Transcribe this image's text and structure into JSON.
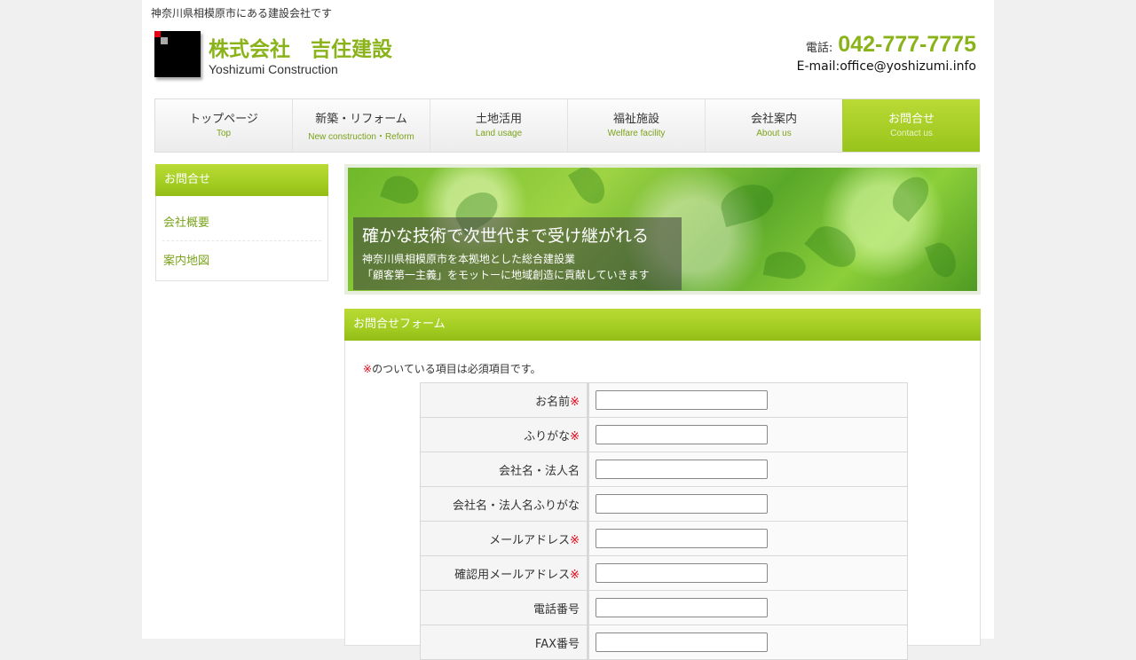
{
  "header": {
    "tagline": "神奈川県相模原市にある建設会社です",
    "company_name": "株式会社　吉住建設",
    "company_en": "Yoshizumi Construction",
    "tel_label": "電話:",
    "tel_number": "042-777-7775",
    "email": "E-mail:office@yoshizumi.info"
  },
  "nav": [
    {
      "jp": "トップページ",
      "en": "Top"
    },
    {
      "jp": "新築・リフォーム",
      "en": "New construction・Reform"
    },
    {
      "jp": "土地活用",
      "en": "Land usage"
    },
    {
      "jp": "福祉施設",
      "en": "Welfare facility"
    },
    {
      "jp": "会社案内",
      "en": "About us"
    },
    {
      "jp": "お問合せ",
      "en": "Contact us"
    }
  ],
  "sidebar": {
    "title": "お問合せ",
    "items": [
      "会社概要",
      "案内地図"
    ]
  },
  "hero": {
    "title": "確かな技術で次世代まで受け継がれる",
    "line1": "神奈川県相模原市を本拠地とした総合建設業",
    "line2": "「顧客第一主義」をモットーに地域創造に貢献していきます"
  },
  "form": {
    "title": "お問合せフォーム",
    "required_mark": "※",
    "note": "のついている項目は必須項目です。",
    "fields": [
      {
        "label": "お名前",
        "required": "※",
        "value": ""
      },
      {
        "label": "ふりがな",
        "required": "※",
        "value": ""
      },
      {
        "label": "会社名・法人名",
        "required": "",
        "value": ""
      },
      {
        "label": "会社名・法人名ふりがな",
        "required": "",
        "value": ""
      },
      {
        "label": "メールアドレス",
        "required": "※",
        "value": ""
      },
      {
        "label": "確認用メールアドレス",
        "required": "※",
        "value": ""
      },
      {
        "label": "電話番号",
        "required": "",
        "value": ""
      },
      {
        "label": "FAX番号",
        "required": "",
        "value": ""
      }
    ]
  },
  "colors": {
    "accent": "#8ab31a",
    "required": "#e60012"
  }
}
